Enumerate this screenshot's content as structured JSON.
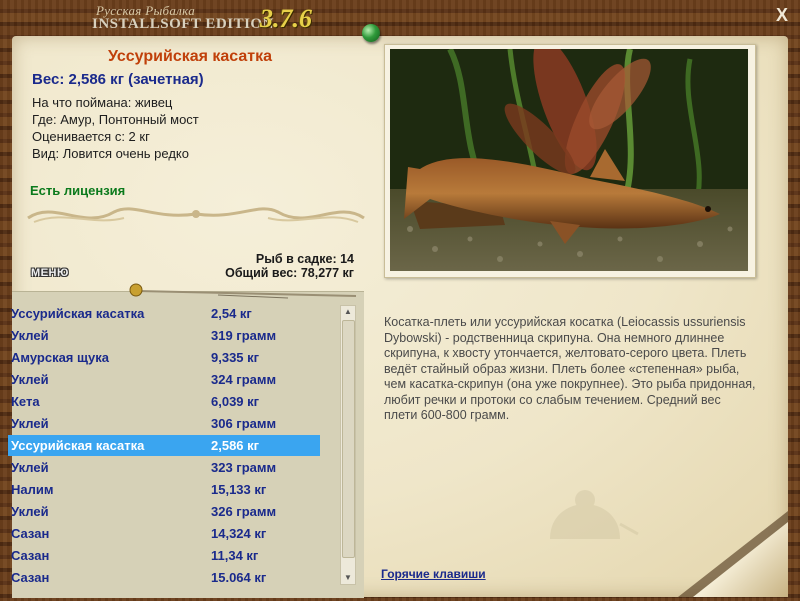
{
  "app": {
    "title_small": "Русская Рыбалка",
    "title_edition": "INSTALLSOFT EDITION",
    "version": "3.7.6",
    "close_label": "X"
  },
  "fish_card": {
    "name": "Уссурийская касатка",
    "weight": "Вес: 2,586 кг (зачетная)",
    "bait": "На что поймана: живец",
    "location": "Где: Амур, Понтонный мост",
    "rated_from": "Оценивается с: 2 кг",
    "rarity": "Вид: Ловится очень редко",
    "license": "Есть лицензия"
  },
  "catch_stats": {
    "fish_in_keepnet": "Рыб в садке: 14",
    "total_weight": "Общий вес: 78,277 кг"
  },
  "menu_label": "МЕНЮ",
  "catch_list": [
    {
      "name": "Уссурийская касатка",
      "weight": "2,54 кг",
      "selected": false
    },
    {
      "name": "Уклей",
      "weight": "319 грамм",
      "selected": false
    },
    {
      "name": "Амурская щука",
      "weight": "9,335 кг",
      "selected": false
    },
    {
      "name": "Уклей",
      "weight": "324 грамм",
      "selected": false
    },
    {
      "name": "Кета",
      "weight": "6,039 кг",
      "selected": false
    },
    {
      "name": "Уклей",
      "weight": "306 грамм",
      "selected": false
    },
    {
      "name": "Уссурийская касатка",
      "weight": "2,586 кг",
      "selected": true
    },
    {
      "name": "Уклей",
      "weight": "323 грамм",
      "selected": false
    },
    {
      "name": "Налим",
      "weight": "15,133 кг",
      "selected": false
    },
    {
      "name": "Уклей",
      "weight": "326 грамм",
      "selected": false
    },
    {
      "name": "Сазан",
      "weight": "14,324 кг",
      "selected": false
    },
    {
      "name": "Сазан",
      "weight": "11,34 кг",
      "selected": false
    },
    {
      "name": "Сазан",
      "weight": "15.064 кг",
      "selected": false
    }
  ],
  "description": "Косатка-плеть или уссурийская косатка (Leiocassis ussuriensis Dybowski) - родственница скрипуна. Она немного длиннее скрипуна, к хвосту утончается, желтовато-серого цвета. Плеть ведёт стайный образ жизни. Плеть более «степенная» рыба, чем касатка-скрипун (она уже покрупнее). Это рыба придонная, любит речки и протоки со слабым течением. Средний вес плети 600-800 грамм.",
  "hotkeys_label": "Горячие клавиши",
  "icons": {
    "close": "close-icon",
    "pin": "green-pin-icon",
    "scroll_up": "chevron-up-icon",
    "scroll_down": "chevron-down-icon"
  },
  "colors": {
    "fish_title": "#c0400a",
    "weight_text": "#1a2a8c",
    "license": "#0b7a1c",
    "selection": "#3aa5f0",
    "version": "#e8d04a"
  }
}
